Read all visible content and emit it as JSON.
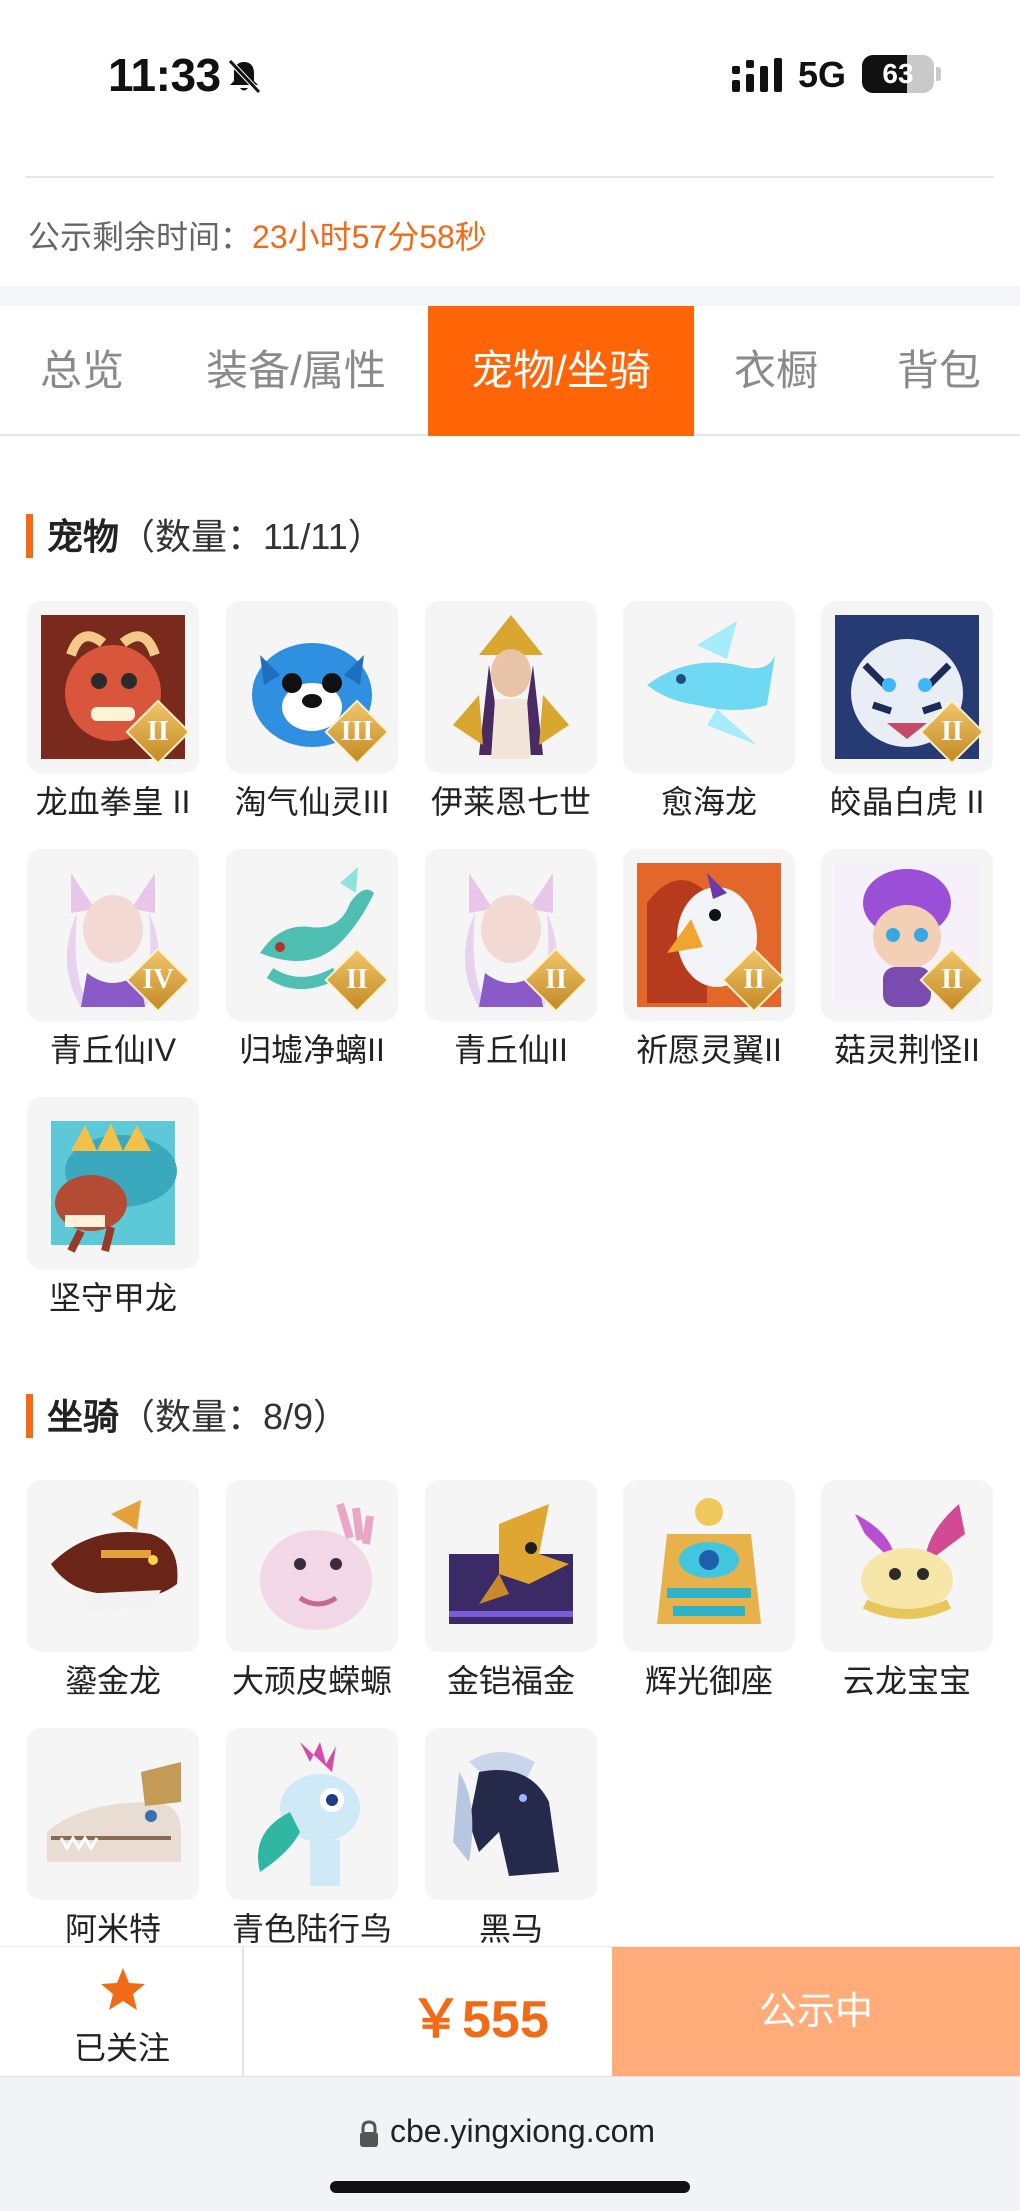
{
  "status_bar": {
    "time": "11:33",
    "network": "5G",
    "battery": "63",
    "battery_level": 0.63
  },
  "notice": {
    "label": "公示剩余时间：",
    "countdown": "23小时57分58秒"
  },
  "tabs": [
    {
      "label": "总览",
      "active": false
    },
    {
      "label": "装备/属性",
      "active": false
    },
    {
      "label": "宠物/坐骑",
      "active": true
    },
    {
      "label": "衣橱",
      "active": false
    },
    {
      "label": "背包",
      "active": false
    }
  ],
  "pets": {
    "title": "宠物",
    "count": "（数量：11/11）",
    "items": [
      {
        "name": "龙血拳皇 II",
        "badge": "II",
        "icon": "red-dragon-pet"
      },
      {
        "name": "淘气仙灵III",
        "badge": "III",
        "icon": "blue-puppy-pet"
      },
      {
        "name": "伊莱恩七世",
        "badge": "",
        "icon": "golden-queen-pet"
      },
      {
        "name": "愈海龙",
        "badge": "",
        "icon": "ice-dragon-pet"
      },
      {
        "name": "皎晶白虎 II",
        "badge": "II",
        "icon": "white-tiger-pet"
      },
      {
        "name": "青丘仙IV",
        "badge": "IV",
        "icon": "fox-fairy-pet"
      },
      {
        "name": "归墟净螭II",
        "badge": "II",
        "icon": "cyan-dragon-pet"
      },
      {
        "name": "青丘仙II",
        "badge": "II",
        "icon": "fox-fairy-pet"
      },
      {
        "name": "祈愿灵翼II",
        "badge": "II",
        "icon": "fire-eagle-pet"
      },
      {
        "name": "菇灵荆怪II",
        "badge": "II",
        "icon": "purple-elf-pet"
      },
      {
        "name": "坚守甲龙",
        "badge": "",
        "icon": "armored-dragon-pet"
      }
    ]
  },
  "mounts": {
    "title": "坐骑",
    "count": "（数量：8/9）",
    "items": [
      {
        "name": "鎏金龙",
        "icon": "gilded-dragon-mount"
      },
      {
        "name": "大顽皮蝾螈",
        "icon": "axolotl-mount"
      },
      {
        "name": "金铠福金",
        "icon": "gold-armor-mount"
      },
      {
        "name": "辉光御座",
        "icon": "radiant-throne-mount"
      },
      {
        "name": "云龙宝宝",
        "icon": "cloud-dragon-mount"
      },
      {
        "name": "阿米特",
        "icon": "crocodile-mount"
      },
      {
        "name": "青色陆行鸟",
        "icon": "cyan-bird-mount"
      },
      {
        "name": "黑马",
        "icon": "black-horse-mount"
      }
    ]
  },
  "action_bar": {
    "follow_label": "已关注",
    "price": "￥555",
    "status_label": "公示中"
  },
  "browser": {
    "url": "cbe.yingxiong.com"
  },
  "colors": {
    "accent": "#ff6506",
    "price": "#f26a15",
    "status_btn": "#ffab7a"
  }
}
